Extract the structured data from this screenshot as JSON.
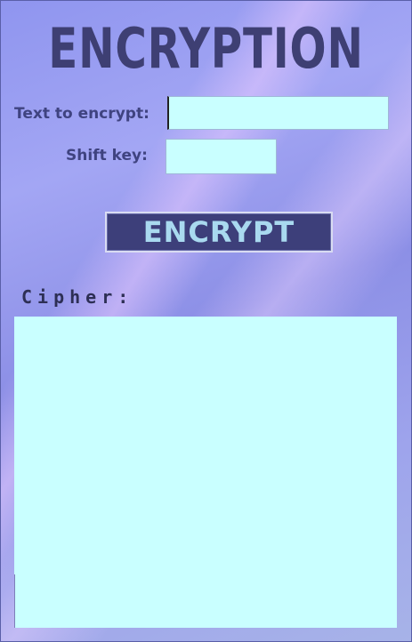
{
  "title": "ENCRYPTION",
  "form": {
    "text_label": "Text to encrypt:",
    "text_value": "",
    "shift_label": "Shift key:",
    "shift_value": ""
  },
  "encrypt_button": "ENCRYPT",
  "cipher": {
    "label": "Cipher:",
    "value": ""
  },
  "colors": {
    "field_bg": "#c9ffff",
    "title": "#3e3f73",
    "button_bg": "#3d3f7a",
    "button_text": "#a9d9ef"
  }
}
